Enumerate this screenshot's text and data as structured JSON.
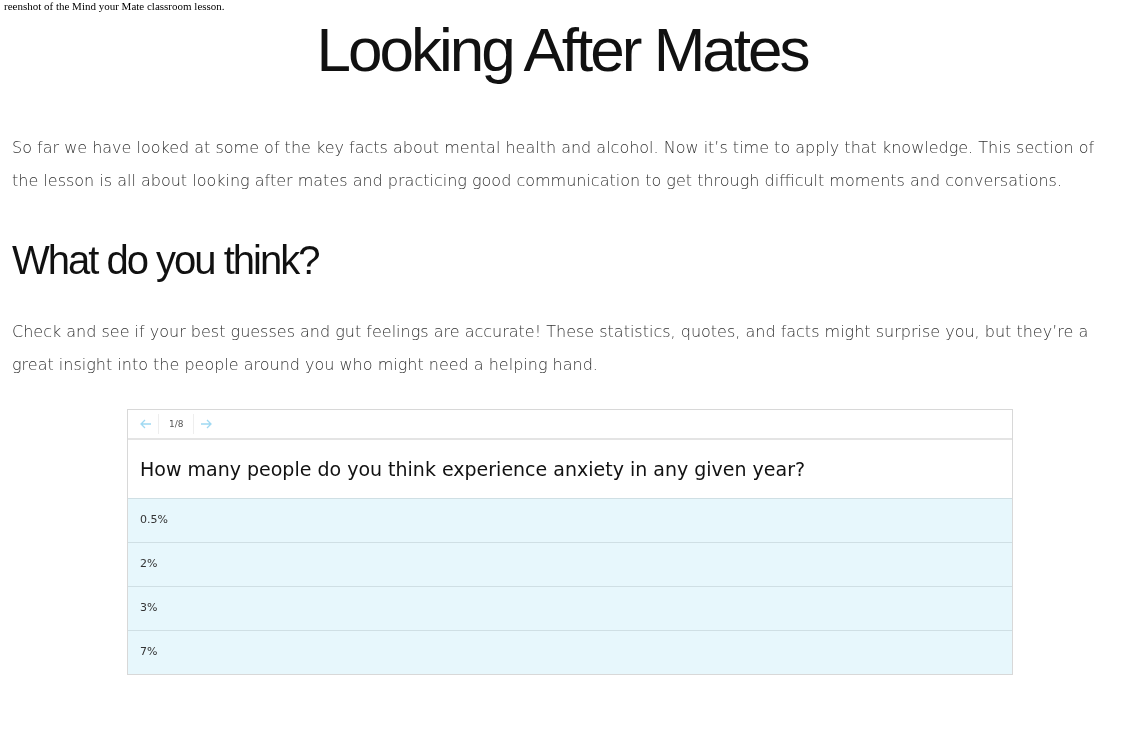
{
  "caption": "reenshot of the Mind your Mate classroom lesson.",
  "title": "Looking After Mates",
  "intro": "So far we have looked at some of the key facts about mental health and alcohol. Now it’s time to apply that knowledge. This section of the lesson is all about looking after mates and practicing good communication to get through difficult moments and conversations.",
  "section": {
    "heading": "What do you think?",
    "text": "Check and see if your best guesses and gut feelings are accurate! These statistics, quotes, and facts might surprise you, but they’re a great insight into the people around you who might need a helping hand."
  },
  "quiz": {
    "counter": "1/8",
    "question": "How many people do you think experience anxiety in any given year?",
    "options": [
      {
        "label": "0.5%"
      },
      {
        "label": "2%"
      },
      {
        "label": "3%"
      },
      {
        "label": "7%"
      }
    ]
  }
}
